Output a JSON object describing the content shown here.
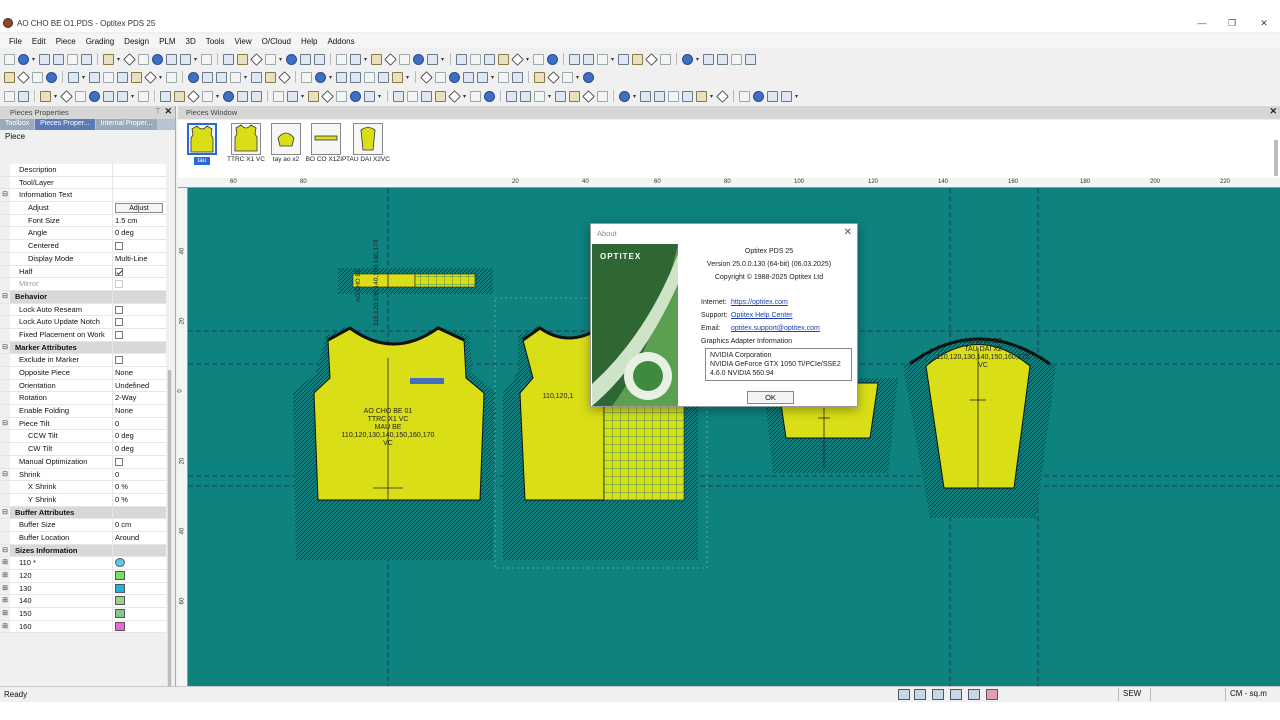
{
  "window": {
    "title": "AO CHO BE O1.PDS - Optitex PDS 25",
    "minimize_glyph": "—",
    "maximize_glyph": "❐",
    "close_glyph": "✕"
  },
  "menu": [
    "File",
    "Edit",
    "Piece",
    "Grading",
    "Design",
    "PLM",
    "3D",
    "Tools",
    "View",
    "O/Cloud",
    "Help",
    "Addons"
  ],
  "left_panel": {
    "title": "Pieces Properties",
    "pin_glyph": "📌",
    "close_glyph": "✕",
    "tabs": [
      "Toolbox",
      "Pieces Proper...",
      "Internal Proper..."
    ],
    "section_label": "Piece",
    "rows": [
      {
        "exp": "",
        "name": "Description",
        "value": "",
        "kind": "text",
        "level": "l0b"
      },
      {
        "exp": "",
        "name": "Tool/Layer",
        "value": "",
        "kind": "text",
        "level": "l0b"
      },
      {
        "exp": "⊟",
        "name": "Information Text",
        "value": "",
        "kind": "text",
        "level": "l0b"
      },
      {
        "exp": "",
        "name": "Adjust",
        "value": "Adjust",
        "kind": "button",
        "level": "l1"
      },
      {
        "exp": "",
        "name": "Font Size",
        "value": "1.5 cm",
        "kind": "text",
        "level": "l1"
      },
      {
        "exp": "",
        "name": "Angle",
        "value": "0 deg",
        "kind": "text",
        "level": "l1"
      },
      {
        "exp": "",
        "name": "Centered",
        "value": "",
        "kind": "check",
        "checked": false,
        "level": "l1"
      },
      {
        "exp": "",
        "name": "Display Mode",
        "value": "Multi-Line",
        "kind": "text",
        "level": "l1"
      },
      {
        "exp": "",
        "name": "Half",
        "value": "",
        "kind": "check",
        "checked": true,
        "level": "l0b"
      },
      {
        "exp": "",
        "name": "Mirror",
        "value": "",
        "kind": "check",
        "checked": false,
        "level": "l0b",
        "disabled": true
      },
      {
        "exp": "⊟",
        "name": "Behavior",
        "value": "",
        "kind": "category"
      },
      {
        "exp": "",
        "name": "Lock Auto Reseam",
        "value": "",
        "kind": "check",
        "checked": false,
        "level": "l0b"
      },
      {
        "exp": "",
        "name": "Lock Auto Update Notch",
        "value": "",
        "kind": "check",
        "checked": false,
        "level": "l0b"
      },
      {
        "exp": "",
        "name": "Fixed Placement on Work",
        "value": "",
        "kind": "check",
        "checked": false,
        "level": "l0b"
      },
      {
        "exp": "⊟",
        "name": "Marker Attributes",
        "value": "",
        "kind": "category"
      },
      {
        "exp": "",
        "name": "Exclude in Marker",
        "value": "",
        "kind": "check",
        "checked": false,
        "level": "l0b"
      },
      {
        "exp": "",
        "name": "Opposite Piece",
        "value": "None",
        "kind": "text",
        "level": "l0b"
      },
      {
        "exp": "",
        "name": "Orientation",
        "value": "Undefined",
        "kind": "text",
        "level": "l0b"
      },
      {
        "exp": "",
        "name": "Rotation",
        "value": "2-Way",
        "kind": "text",
        "level": "l0b"
      },
      {
        "exp": "",
        "name": "Enable Folding",
        "value": "None",
        "kind": "text",
        "level": "l0b"
      },
      {
        "exp": "⊟",
        "name": "Piece Tilt",
        "value": "0",
        "kind": "text",
        "level": "l0b"
      },
      {
        "exp": "",
        "name": "CCW Tilt",
        "value": "0 deg",
        "kind": "text",
        "level": "l1"
      },
      {
        "exp": "",
        "name": "CW Tilt",
        "value": "0 deg",
        "kind": "text",
        "level": "l1"
      },
      {
        "exp": "",
        "name": "Manual Optimization",
        "value": "",
        "kind": "check",
        "checked": false,
        "level": "l0b"
      },
      {
        "exp": "⊟",
        "name": "Shrink",
        "value": "0",
        "kind": "text",
        "level": "l0b"
      },
      {
        "exp": "",
        "name": "X Shrink",
        "value": "0 %",
        "kind": "text",
        "level": "l1"
      },
      {
        "exp": "",
        "name": "Y Shrink",
        "value": "0 %",
        "kind": "text",
        "level": "l1"
      },
      {
        "exp": "⊟",
        "name": "Buffer Attributes",
        "value": "",
        "kind": "category"
      },
      {
        "exp": "",
        "name": "Buffer Size",
        "value": "0 cm",
        "kind": "text",
        "level": "l0b"
      },
      {
        "exp": "",
        "name": "Buffer Location",
        "value": "Around",
        "kind": "text",
        "level": "l0b"
      },
      {
        "exp": "⊟",
        "name": "Sizes Information",
        "value": "",
        "kind": "category"
      },
      {
        "exp": "⊞",
        "name": "110 *",
        "value": "",
        "kind": "swatch",
        "color": "#5ec8e8",
        "circle": true,
        "level": "l0b"
      },
      {
        "exp": "⊞",
        "name": "120",
        "value": "",
        "kind": "swatch",
        "color": "#7be05a",
        "level": "l0b"
      },
      {
        "exp": "⊞",
        "name": "130",
        "value": "",
        "kind": "swatch",
        "color": "#26b2d6",
        "level": "l0b"
      },
      {
        "exp": "⊞",
        "name": "140",
        "value": "",
        "kind": "swatch",
        "color": "#9ad08a",
        "level": "l0b"
      },
      {
        "exp": "⊞",
        "name": "150",
        "value": "",
        "kind": "swatch",
        "color": "#86c88a",
        "level": "l0b"
      },
      {
        "exp": "⊞",
        "name": "160",
        "value": "",
        "kind": "swatch",
        "color": "#e86ad6",
        "level": "l0b"
      }
    ]
  },
  "pieces_window": {
    "title": "Pieces Window",
    "close_glyph": "✕",
    "thumbnails": [
      {
        "label": "tau",
        "shape": "body",
        "selected": true
      },
      {
        "label": "TTRC X1 VC",
        "shape": "body",
        "selected": false
      },
      {
        "label": "tay ao x2",
        "shape": "sleeve",
        "selected": false
      },
      {
        "label": "BO CO X1ZIP",
        "shape": "bar",
        "selected": false
      },
      {
        "label": "TAU DAI X2VC",
        "shape": "long",
        "selected": false
      }
    ],
    "ruler_h": [
      "60",
      "80",
      "20",
      "40",
      "60",
      "80",
      "100",
      "120",
      "140",
      "160",
      "180",
      "200",
      "220"
    ],
    "ruler_v": [
      "40",
      "20",
      "0",
      "20",
      "40",
      "60"
    ],
    "piece_text": {
      "front": [
        "AO CHO BE 01",
        "TTRC X1 VC",
        "MAU BE",
        "110,120,130,140,150,160,170",
        "VC"
      ],
      "back_partial": "110,120,1",
      "right_piece": [
        "AO CHO BE",
        "TAU DAI X2",
        "110,120,130,140,150,160,170",
        "VC"
      ],
      "collar_vertical": "110,120,130,140,150,160,170",
      "small_label": "AO CHO BE"
    },
    "fill_color": "#d9de17",
    "canvas_color": "#0e827f"
  },
  "about": {
    "title": "About",
    "close_glyph": "✕",
    "brand": "OPTITEX",
    "product": "Optitex PDS 25",
    "version": "Version 25.0.0.130  (64-bit) (06.03.2025)",
    "copyright": "Copyright © 1988-2025 Optitex Ltd",
    "internet_label": "Internet:",
    "internet_value": "https://optitex.com",
    "support_label": "Support:",
    "support_value": "Optitex Help Center",
    "email_label": "Email:",
    "email_value": "optitex.support@optitex.com",
    "graphics_label": "Graphics Adapter Information",
    "graphics_lines": [
      "NVIDIA Corporation",
      "NVIDIA GeForce GTX 1050 Ti/PCIe/SSE2",
      "4.6.0 NVIDIA 560.94"
    ],
    "ok_label": "OK"
  },
  "status": {
    "ready": "Ready",
    "mode": "SEW",
    "units": "CM - sq.m"
  }
}
